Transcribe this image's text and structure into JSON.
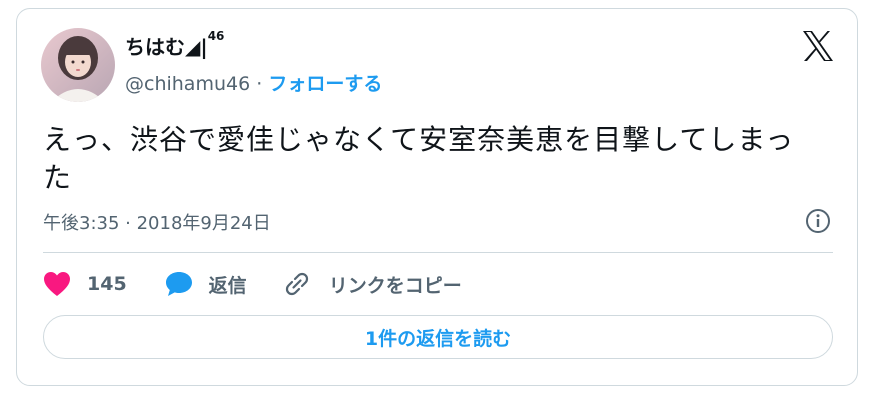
{
  "author": {
    "display_name": "ちはむ◢|",
    "display_name_sup": "46",
    "handle": "@chihamu46",
    "separator": "·",
    "follow_label": "フォローする"
  },
  "tweet": {
    "text": "えっ、渋谷で愛佳じゃなくて安室奈美恵を目撃してしまった",
    "timestamp": "午後3:35 · 2018年9月24日"
  },
  "actions": {
    "like_count": "145",
    "reply_label": "返信",
    "copy_link_label": "リンクをコピー"
  },
  "read_replies_label": "1件の返信を読む",
  "colors": {
    "accent": "#1d9bf0",
    "like": "#f91880",
    "text": "#0f1419",
    "muted": "#536471",
    "border": "#cfd9de"
  },
  "icons": [
    "x-logo-icon",
    "info-icon",
    "heart-icon",
    "reply-bubble-icon",
    "link-icon"
  ]
}
